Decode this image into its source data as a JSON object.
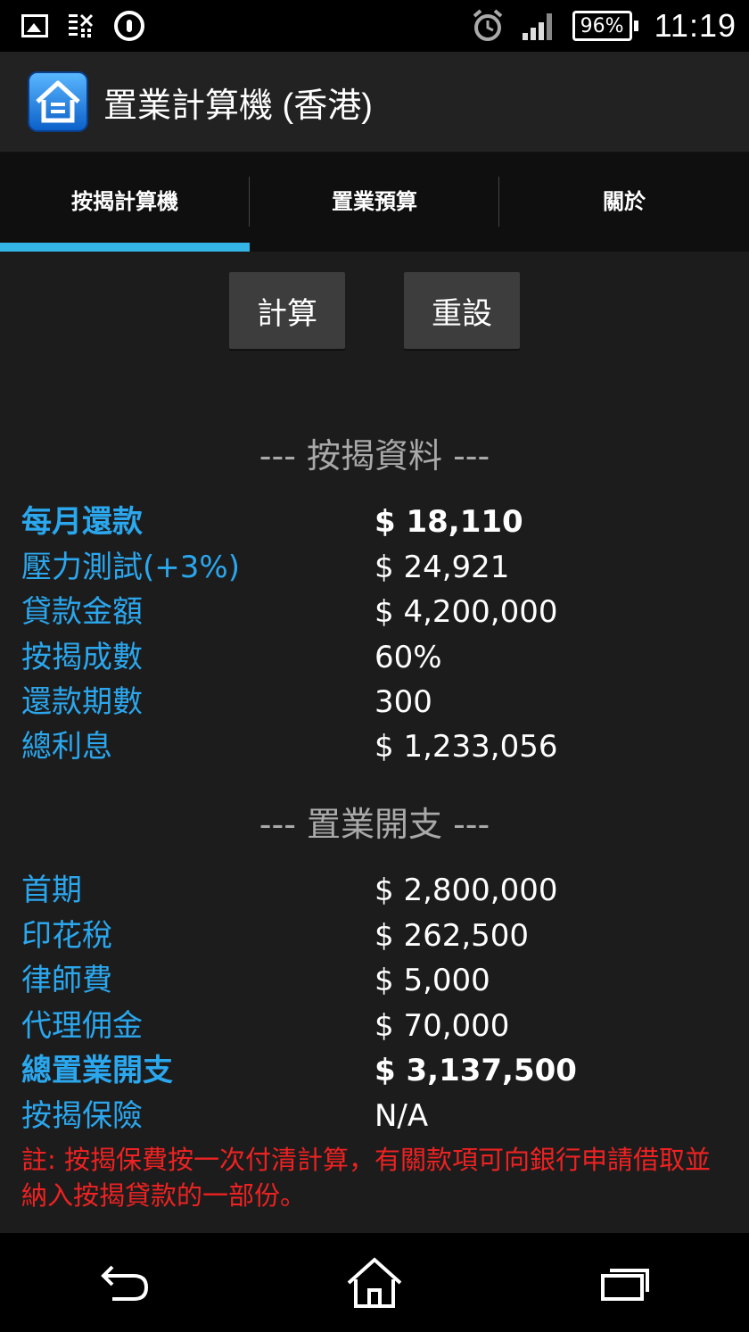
{
  "status_bar": {
    "battery": "96%",
    "time": "11:19",
    "icons": [
      "image-icon",
      "data-grid-icon",
      "circle-app-icon",
      "alarm-icon",
      "signal-icon",
      "battery-icon"
    ]
  },
  "app": {
    "title": "置業計算機 (香港)",
    "icon": "house-icon",
    "accent_color": "#33b5e5",
    "label_color": "#2ba7ee",
    "note_color": "#ee2222"
  },
  "tabs": [
    {
      "label": "按揭計算機",
      "active": true
    },
    {
      "label": "置業預算",
      "active": false
    },
    {
      "label": "關於",
      "active": false
    }
  ],
  "actions": {
    "calculate": "計算",
    "reset": "重設"
  },
  "mortgage": {
    "title": "--- 按揭資料 ---",
    "rows": [
      {
        "label": "每月還款",
        "value": "$ 18,110"
      },
      {
        "label": "壓力測試(+3%)",
        "value": "$ 24,921"
      },
      {
        "label": "貸款金額",
        "value": "$ 4,200,000"
      },
      {
        "label": "按揭成數",
        "value": "60%"
      },
      {
        "label": "還款期數",
        "value": "300"
      },
      {
        "label": "總利息",
        "value": "$ 1,233,056"
      }
    ]
  },
  "expenses": {
    "title": "--- 置業開支 ---",
    "rows": [
      {
        "label": "首期",
        "value": "$ 2,800,000"
      },
      {
        "label": "印花稅",
        "value": "$ 262,500"
      },
      {
        "label": "律師費",
        "value": "$ 5,000"
      },
      {
        "label": "代理佣金",
        "value": "$ 70,000"
      },
      {
        "label": "總置業開支",
        "value": "$ 3,137,500"
      },
      {
        "label": "按揭保險",
        "value": "N/A"
      }
    ]
  },
  "note": "註: 按揭保費按一次付清計算，有關款項可向銀行申請借取並納入按揭貸款的一部份。"
}
